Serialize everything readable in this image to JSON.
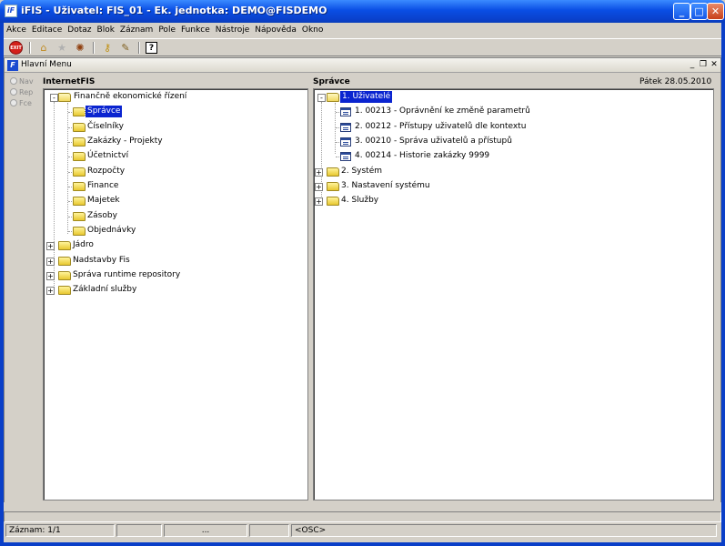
{
  "window": {
    "title": "iFIS - Uživatel: FIS_01 - Ek. jednotka: DEMO@FISDEMO",
    "app_icon": "iF"
  },
  "menu": [
    "Akce",
    "Editace",
    "Dotaz",
    "Blok",
    "Záznam",
    "Pole",
    "Funkce",
    "Nástroje",
    "Nápověda",
    "Okno"
  ],
  "toolbar": {
    "exit_label": "EXIT",
    "icons": [
      "exit-icon",
      "home-icon",
      "star-icon",
      "bug-icon",
      "key-icon",
      "edit-icon",
      "help-icon"
    ]
  },
  "inner_window": {
    "title": "Hlavní Menu",
    "icon": "F"
  },
  "radios": [
    "Nav",
    "Rep",
    "Fce"
  ],
  "left_panel": {
    "label": "InternetFIS",
    "root": "Finančně ekonomické řízení",
    "children": [
      "Správce",
      "Číselníky",
      "Zakázky - Projekty",
      "Účetnictví",
      "Rozpočty",
      "Finance",
      "Majetek",
      "Zásoby",
      "Objednávky"
    ],
    "others": [
      "Jádro",
      "Nadstavby Fis",
      "Správa runtime repository",
      "Základní služby"
    ]
  },
  "right_panel": {
    "label": "Správce",
    "date": "Pátek  28.05.2010",
    "root": "1.  Uživatelé",
    "items": [
      "1.  00213 - Oprávnění ke změně parametrů",
      "2.  00212 - Přístupy uživatelů dle kontextu",
      "3.  00210 - Správa uživatelů a přístupů",
      "4.  00214 - Historie zakázky 9999"
    ],
    "others": [
      "2.  Systém",
      "3.  Nastavení systému",
      "4.  Služby"
    ]
  },
  "status": {
    "record": "Záznam: 1/1",
    "ellipsis": "...",
    "osc": "<OSC>"
  }
}
